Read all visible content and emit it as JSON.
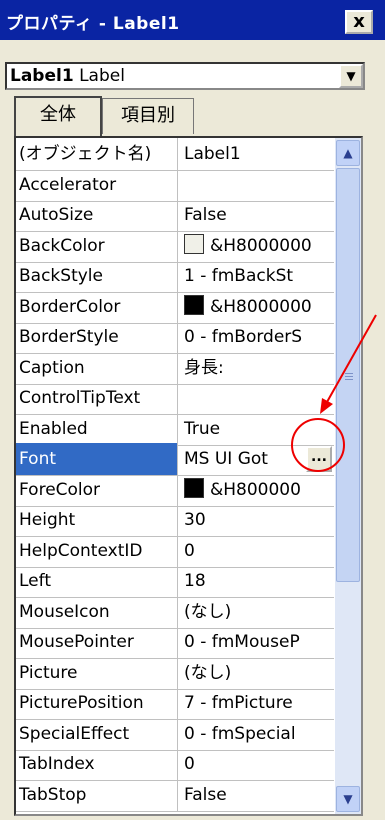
{
  "window": {
    "title": "プロパティ - Label1",
    "close_label": "x"
  },
  "object_selector": {
    "name": "Label1",
    "type": "Label"
  },
  "tabs": [
    {
      "label": "全体",
      "active": true
    },
    {
      "label": "項目別",
      "active": false
    }
  ],
  "properties": [
    {
      "name": "(オブジェクト名)",
      "value": "Label1"
    },
    {
      "name": "Accelerator",
      "value": ""
    },
    {
      "name": "AutoSize",
      "value": "False"
    },
    {
      "name": "BackColor",
      "value": "&H8000000",
      "swatch": "#f0f0e8"
    },
    {
      "name": "BackStyle",
      "value": "1 - fmBackSt"
    },
    {
      "name": "BorderColor",
      "value": "&H8000000",
      "swatch": "#000000"
    },
    {
      "name": "BorderStyle",
      "value": "0 - fmBorderS"
    },
    {
      "name": "Caption",
      "value": "身長:"
    },
    {
      "name": "ControlTipText",
      "value": ""
    },
    {
      "name": "Enabled",
      "value": "True"
    },
    {
      "name": "Font",
      "value": "MS UI Got",
      "selected": true,
      "has_ellipsis": true
    },
    {
      "name": "ForeColor",
      "value": "&H800000",
      "swatch": "#000000"
    },
    {
      "name": "Height",
      "value": "30"
    },
    {
      "name": "HelpContextID",
      "value": "0"
    },
    {
      "name": "Left",
      "value": "18"
    },
    {
      "name": "MouseIcon",
      "value": "(なし)"
    },
    {
      "name": "MousePointer",
      "value": "0 - fmMouseP"
    },
    {
      "name": "Picture",
      "value": "(なし)"
    },
    {
      "name": "PicturePosition",
      "value": "7 - fmPicture"
    },
    {
      "name": "SpecialEffect",
      "value": "0 - fmSpecial"
    },
    {
      "name": "TabIndex",
      "value": "0"
    },
    {
      "name": "TabStop",
      "value": "False"
    }
  ],
  "ellipsis_label": "...",
  "scroll": {
    "up_icon": "▲",
    "down_icon": "▼"
  },
  "colors": {
    "titlebar": "#0a24a3",
    "selection": "#316ac5",
    "annotation": "#ee0000"
  }
}
